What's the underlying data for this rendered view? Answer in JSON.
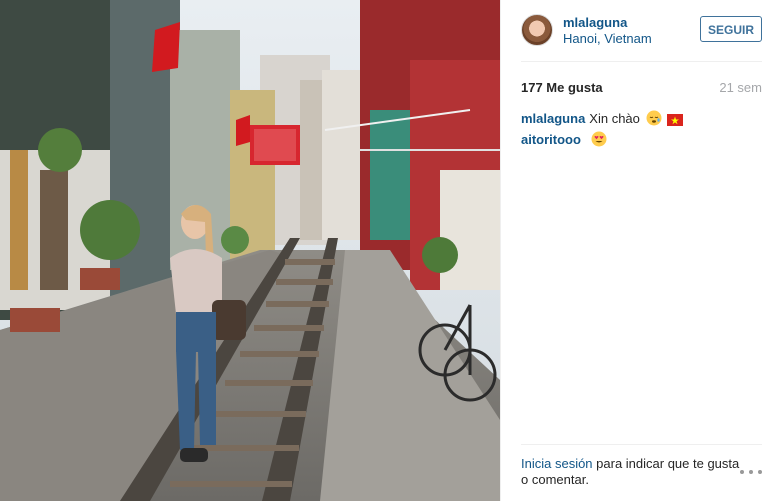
{
  "post": {
    "username": "mlalaguna",
    "location": "Hanoi, Vietnam",
    "follow_label": "SEGUIR",
    "likes": "177 Me gusta",
    "time_ago": "21 sem",
    "caption": {
      "author": "mlalaguna",
      "text": "Xin chào",
      "emojis": [
        "sleepy-face-emoji",
        "vietnam-flag-emoji"
      ]
    },
    "comments": [
      {
        "author": "aitoritooo",
        "emojis": [
          "heart-eyes-emoji"
        ]
      }
    ],
    "footer": {
      "login_link": "Inicia sesión",
      "login_text": " para indicar que te gusta o comentar."
    }
  },
  "colors": {
    "link_blue": "#125688",
    "button_blue": "#3f729b",
    "muted_gray": "#a5a7aa",
    "divider": "#efefef"
  },
  "icons": {
    "avatar": "profile-photo",
    "more": "more-options-icon"
  }
}
